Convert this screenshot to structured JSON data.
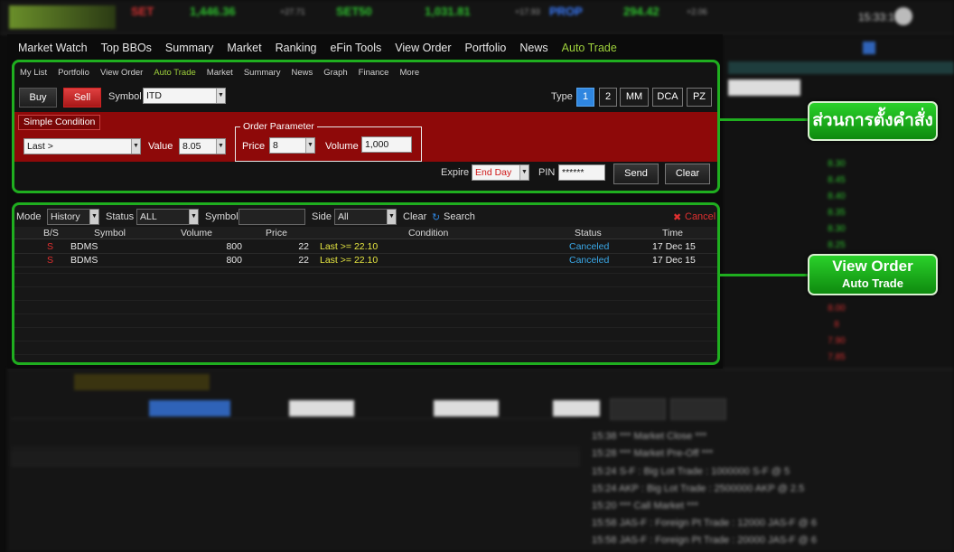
{
  "menu": [
    "Market Watch",
    "Top BBOs",
    "Summary",
    "Market",
    "Ranking",
    "eFin Tools",
    "View Order",
    "Portfolio",
    "News",
    "Auto Trade"
  ],
  "menu_active_index": 9,
  "subnav": [
    "My List",
    "Portfolio",
    "View Order",
    "Auto Trade",
    "Market",
    "Summary",
    "News",
    "Graph",
    "Finance",
    "More"
  ],
  "subnav_active_index": 3,
  "order": {
    "buy_label": "Buy",
    "sell_label": "Sell",
    "symbol_label": "Symbol",
    "symbol_value": "ITD",
    "type_label": "Type",
    "type_options": [
      "1",
      "2",
      "MM",
      "DCA",
      "PZ"
    ],
    "type_selected": "1",
    "simple_condition_label": "Simple Condition",
    "condition_value": "Last >",
    "value_label": "Value",
    "value_value": "8.05",
    "order_parameter_label": "Order Parameter",
    "price_label": "Price",
    "price_value": "8",
    "volume_label": "Volume",
    "volume_value": "1,000",
    "expire_label": "Expire",
    "expire_value": "End Day",
    "pin_label": "PIN",
    "pin_value": "******",
    "send_label": "Send",
    "clear_label": "Clear"
  },
  "view": {
    "mode_label": "Mode",
    "mode_value": "History",
    "status_label": "Status",
    "status_value": "ALL",
    "symbol_label": "Symbol",
    "symbol_value": "",
    "side_label": "Side",
    "side_value": "All",
    "clear_label": "Clear",
    "search_label": "Search",
    "cancel_label": "Cancel",
    "columns": [
      "B/S",
      "Symbol",
      "Volume",
      "Price",
      "Condition",
      "Status",
      "Time"
    ],
    "rows": [
      {
        "bs": "S",
        "symbol": "BDMS",
        "volume": "800",
        "price": "22",
        "condition": "Last >= 22.10",
        "status": "Canceled",
        "time": "17 Dec 15"
      },
      {
        "bs": "S",
        "symbol": "BDMS",
        "volume": "800",
        "price": "22",
        "condition": "Last >= 22.10",
        "status": "Canceled",
        "time": "17 Dec 15"
      }
    ]
  },
  "callouts": {
    "order_setting": "ส่วนการตั้งคำสั่ง",
    "view_order_title": "View Order",
    "view_order_sub": "Auto Trade"
  },
  "colors": {
    "highlight_green": "#1fae1f",
    "active_green": "#9ed13c",
    "order_red": "#8e0909",
    "type_selected_blue": "#2f86e0",
    "status_blue": "#3aa8e8",
    "condition_yellow": "#e6e641"
  }
}
